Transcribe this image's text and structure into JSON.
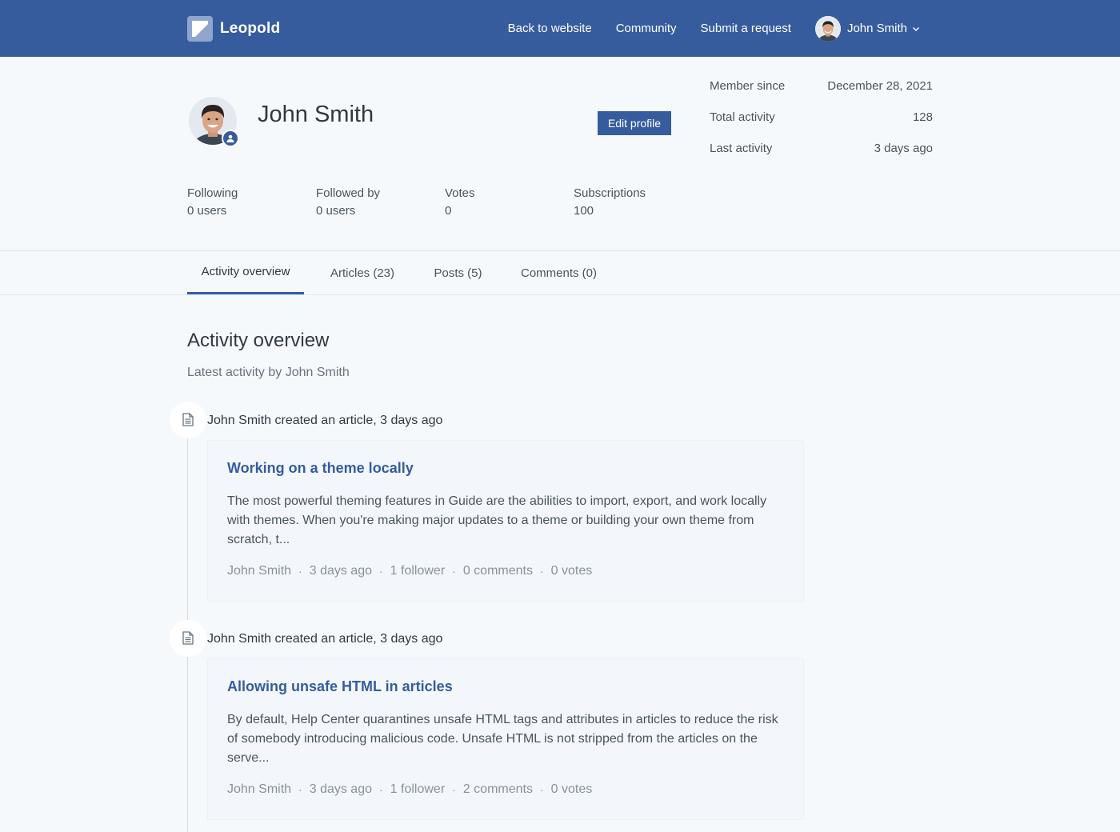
{
  "header": {
    "brand": "Leopold",
    "nav": [
      "Back to website",
      "Community",
      "Submit a request"
    ],
    "user_name": "John Smith"
  },
  "profile": {
    "name": "John Smith",
    "edit_label": "Edit profile",
    "meta": [
      {
        "label": "Member since",
        "value": "December 28, 2021"
      },
      {
        "label": "Total activity",
        "value": "128"
      },
      {
        "label": "Last activity",
        "value": "3 days ago"
      }
    ],
    "stats": [
      {
        "label": "Following",
        "value": "0 users"
      },
      {
        "label": "Followed by",
        "value": "0 users"
      },
      {
        "label": "Votes",
        "value": "0"
      },
      {
        "label": "Subscriptions",
        "value": "100"
      }
    ]
  },
  "tabs": [
    {
      "label": "Activity overview",
      "active": true
    },
    {
      "label": "Articles (23)",
      "active": false
    },
    {
      "label": "Posts (5)",
      "active": false
    },
    {
      "label": "Comments (0)",
      "active": false
    }
  ],
  "activity": {
    "title": "Activity overview",
    "subtitle": "Latest activity by John Smith",
    "entries": [
      {
        "headline": "John Smith created an article, 3 days ago",
        "title": "Working on a theme locally",
        "excerpt": "The most powerful theming features in Guide are the abilities to import, export, and work locally with themes. When you're making major updates to a theme or building your own theme from scratch, t...",
        "meta": [
          "John Smith",
          "3 days ago",
          "1 follower",
          "0 comments",
          "0 votes"
        ]
      },
      {
        "headline": "John Smith created an article, 3 days ago",
        "title": "Allowing unsafe HTML in articles",
        "excerpt": "By default, Help Center quarantines unsafe HTML tags and attributes in articles to reduce the risk of somebody introducing malicious code. Unsafe HTML is not stripped from the articles on the serve...",
        "meta": [
          "John Smith",
          "3 days ago",
          "1 follower",
          "2 comments",
          "0 votes"
        ]
      }
    ]
  },
  "colors": {
    "brand": "#365c9e",
    "background": "#f6f9fc",
    "card": "#f3f7fb"
  }
}
